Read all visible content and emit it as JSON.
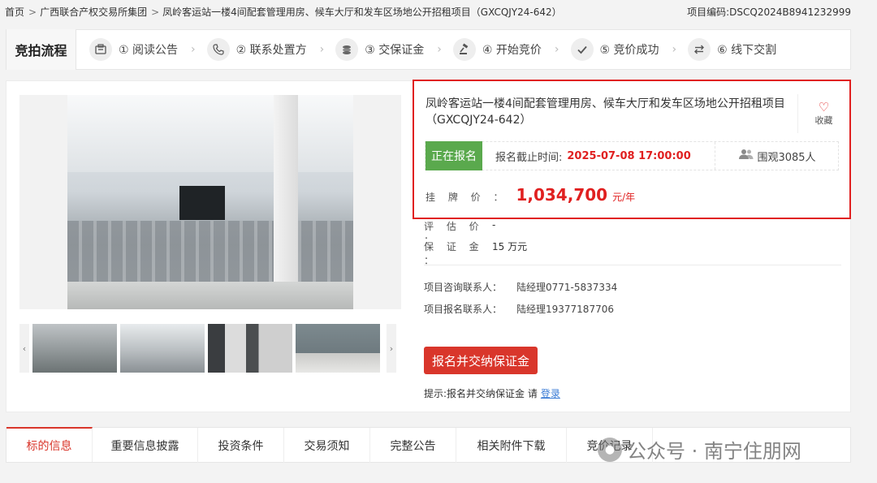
{
  "breadcrumb": {
    "items": [
      "首页",
      "广西联合产权交易所集团",
      "凤岭客运站一楼4间配套管理用房、候车大厅和发车区场地公开招租项目（GXCQJY24-642）"
    ],
    "separator": ">"
  },
  "project_code": "项目编码:DSCQ2024B8941232999",
  "flow": {
    "title": "竞拍流程",
    "steps": [
      {
        "label": "① 阅读公告",
        "icon": "document-icon"
      },
      {
        "label": "② 联系处置方",
        "icon": "phone-icon"
      },
      {
        "label": "③ 交保证金",
        "icon": "coins-icon"
      },
      {
        "label": "④ 开始竞价",
        "icon": "gavel-icon"
      },
      {
        "label": "⑤ 竞价成功",
        "icon": "check-icon"
      },
      {
        "label": "⑥ 线下交割",
        "icon": "swap-icon"
      }
    ]
  },
  "listing": {
    "title": "凤岭客运站一楼4间配套管理用房、候车大厅和发车区场地公开招租项目（GXCQJY24-642）",
    "favorite_label": "收藏",
    "status": "正在报名",
    "deadline_label": "报名截止时间:",
    "deadline_value": "2025-07-08 17:00:00",
    "watchers": "围观3085人",
    "price_label": "挂 牌 价 ：",
    "price_value": "1,034,700",
    "price_unit": "元/年",
    "appraisal_label": "评 估 价 ：",
    "appraisal_value": "-",
    "deposit_label": "保 证 金 ：",
    "deposit_value": "15 万元",
    "contact_consult_label": "项目咨询联系人：",
    "contact_consult_value": "陆经理0771-5837334",
    "contact_signup_label": "项目报名联系人：",
    "contact_signup_value": "陆经理19377187706",
    "signup_button": "报名并交纳保证金",
    "tip_text": "提示:报名并交纳保证金 请",
    "tip_link": "登录"
  },
  "tabs": [
    "标的信息",
    "重要信息披露",
    "投资条件",
    "交易须知",
    "完整公告",
    "相关附件下载",
    "竞价记录"
  ],
  "watermark": "公众号 · 南宁住朋网",
  "colors": {
    "accent": "#d9362b",
    "status_green": "#5aa94d",
    "highlight_border": "#e02020"
  }
}
